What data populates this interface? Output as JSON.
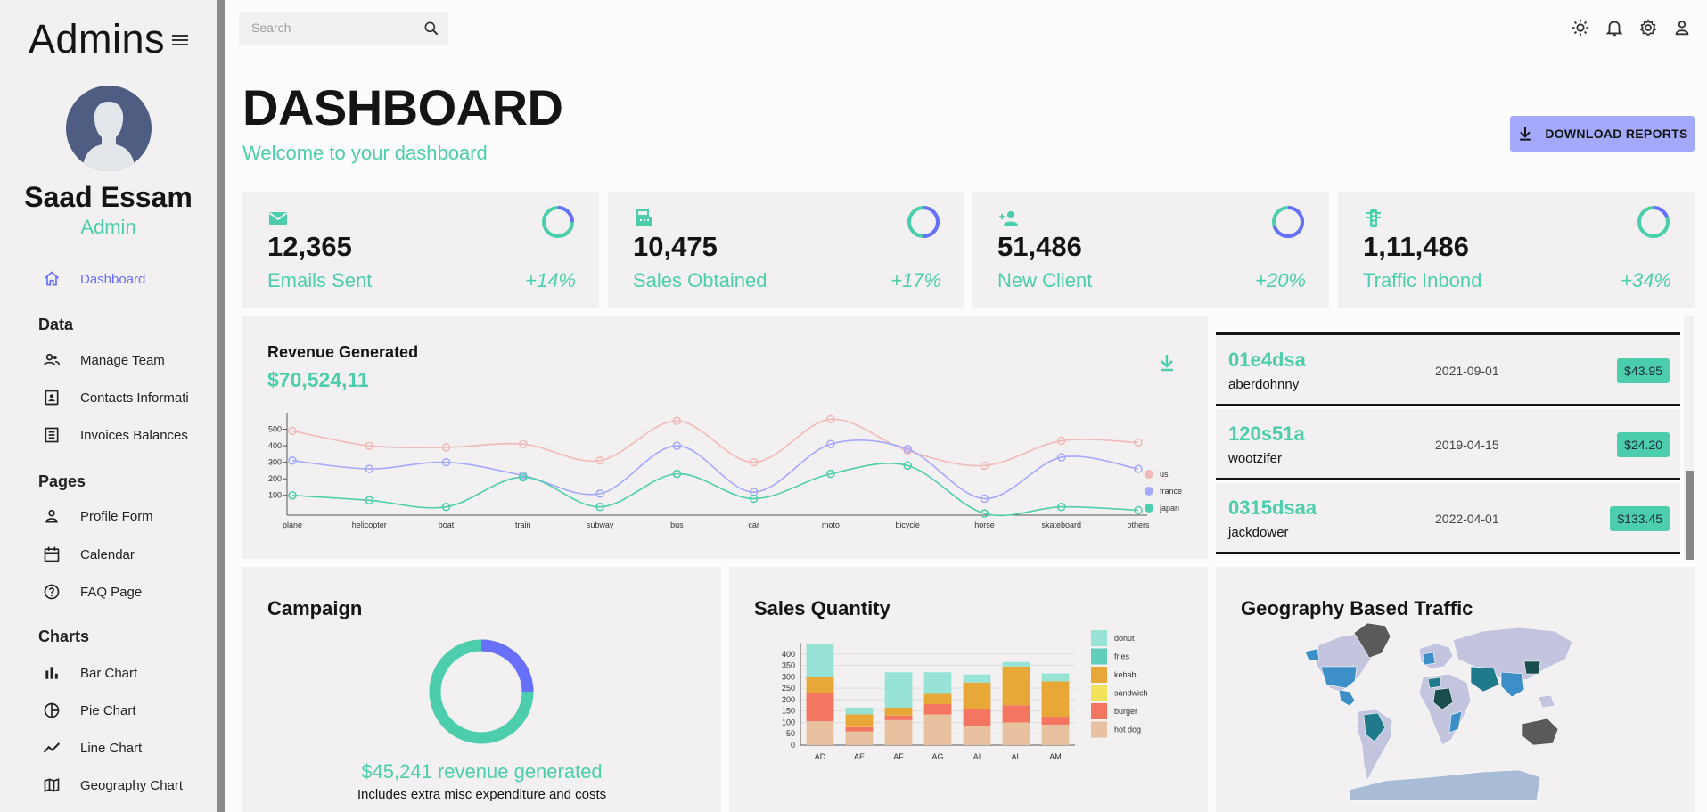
{
  "app": {
    "brand": "Admins"
  },
  "user": {
    "name": "Saad Essam",
    "role": "Admin"
  },
  "sidebar": {
    "dashboard": "Dashboard",
    "sections": {
      "data": "Data",
      "pages": "Pages",
      "charts": "Charts"
    },
    "items": {
      "manage_team": "Manage Team",
      "contacts": "Contacts Informati",
      "invoices": "Invoices Balances",
      "profile": "Profile Form",
      "calendar": "Calendar",
      "faq": "FAQ Page",
      "bar": "Bar Chart",
      "pie": "Pie Chart",
      "line": "Line Chart",
      "geo": "Geography Chart"
    }
  },
  "search": {
    "placeholder": "Search"
  },
  "header": {
    "title": "DASHBOARD",
    "subtitle": "Welcome to your dashboard",
    "download": "DOWNLOAD REPORTS"
  },
  "stats": [
    {
      "value": "12,365",
      "label": "Emails Sent",
      "increase": "+14%",
      "progress": 0.75,
      "icon": "email-icon"
    },
    {
      "value": "10,475",
      "label": "Sales Obtained",
      "increase": "+17%",
      "progress": 0.5,
      "icon": "point-of-sale-icon"
    },
    {
      "value": "51,486",
      "label": "New Client",
      "increase": "+20%",
      "progress": 0.3,
      "icon": "person-add-icon"
    },
    {
      "value": "1,11,486",
      "label": "Traffic Inbond",
      "increase": "+34%",
      "progress": 0.8,
      "icon": "traffic-icon"
    }
  ],
  "revenue": {
    "title": "Revenue Generated",
    "value": "$70,524,11"
  },
  "transactions": [
    {
      "id": "01e4dsa",
      "user": "aberdohnny",
      "date": "2021-09-01",
      "cost": "$43.95"
    },
    {
      "id": "120s51a",
      "user": "wootzifer",
      "date": "2019-04-15",
      "cost": "$24.20"
    },
    {
      "id": "0315dsaa",
      "user": "jackdower",
      "date": "2022-04-01",
      "cost": "$133.45"
    }
  ],
  "campaign": {
    "title": "Campaign",
    "revenue_text": "$45,241 revenue generated",
    "note": "Includes extra misc expenditure and costs",
    "progress": 0.75
  },
  "sales": {
    "title": "Sales Quantity"
  },
  "geo": {
    "title": "Geography Based Traffic"
  },
  "colors": {
    "accent": "#4cceac",
    "primary": "#6870fa",
    "button": "#a4a9fc"
  },
  "chart_data": [
    {
      "type": "line",
      "x": [
        "plane",
        "helicopter",
        "boat",
        "train",
        "subway",
        "bus",
        "car",
        "moto",
        "bicycle",
        "horse",
        "skateboard",
        "others"
      ],
      "series": [
        {
          "name": "us",
          "color": "#f1b9b7",
          "values": [
            490,
            400,
            390,
            410,
            310,
            550,
            300,
            560,
            370,
            280,
            430,
            420
          ]
        },
        {
          "name": "france",
          "color": "#a4a9fc",
          "values": [
            310,
            260,
            300,
            220,
            110,
            400,
            120,
            410,
            380,
            80,
            330,
            260
          ]
        },
        {
          "name": "japan",
          "color": "#4cceac",
          "values": [
            100,
            70,
            30,
            210,
            30,
            230,
            80,
            230,
            280,
            -10,
            30,
            10
          ]
        }
      ],
      "yticks": [
        100,
        200,
        300,
        400,
        500
      ],
      "ylim": [
        -20,
        600
      ]
    },
    {
      "type": "bar",
      "stacked": true,
      "categories": [
        "AD",
        "AE",
        "AF",
        "AG",
        "AI",
        "AL",
        "AM"
      ],
      "series": [
        {
          "name": "hot dog",
          "color": "#e8c1a0",
          "values": [
            105,
            60,
            110,
            135,
            85,
            100,
            90
          ]
        },
        {
          "name": "burger",
          "color": "#f47560",
          "values": [
            125,
            20,
            20,
            45,
            75,
            75,
            35
          ]
        },
        {
          "name": "sandwich",
          "color": "#f1e15b",
          "values": [
            0,
            5,
            0,
            0,
            0,
            0,
            0
          ]
        },
        {
          "name": "kebab",
          "color": "#e8a838",
          "values": [
            70,
            50,
            35,
            45,
            115,
            170,
            155
          ]
        },
        {
          "name": "fries",
          "color": "#61cdbb",
          "values": [
            0,
            0,
            0,
            0,
            0,
            0,
            0
          ]
        },
        {
          "name": "donut",
          "color": "#97e3d5",
          "values": [
            145,
            30,
            155,
            95,
            35,
            20,
            35
          ]
        }
      ],
      "yticks": [
        0,
        50,
        100,
        150,
        200,
        250,
        300,
        350,
        400
      ],
      "ylim": [
        0,
        450
      ]
    }
  ]
}
